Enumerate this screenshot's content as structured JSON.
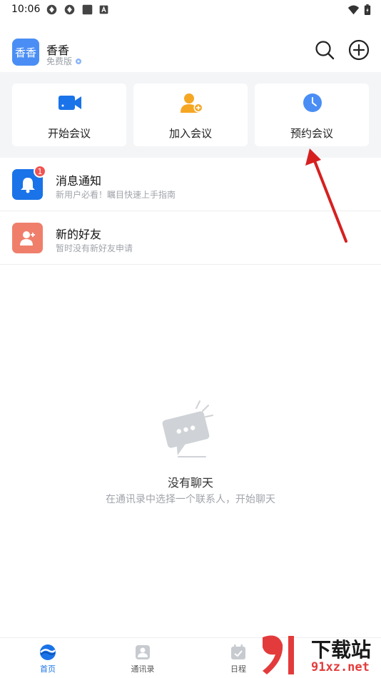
{
  "status_bar": {
    "time": "10:06"
  },
  "header": {
    "avatar_text": "香香",
    "user_name": "香香",
    "plan": "免费版"
  },
  "actions": [
    {
      "label": "开始会议",
      "icon": "video-camera-icon",
      "color": "#1a73e8"
    },
    {
      "label": "加入会议",
      "icon": "add-person-icon",
      "color": "#f5a623"
    },
    {
      "label": "预约会议",
      "icon": "clock-icon",
      "color": "#4a8ef5"
    }
  ],
  "list": [
    {
      "title": "消息通知",
      "subtitle": "新用户必看！瞩目快速上手指南",
      "badge": "1",
      "icon": "bell-icon",
      "color": "#1a73e8"
    },
    {
      "title": "新的好友",
      "subtitle": "暂时没有新好友申请",
      "icon": "add-friend-icon",
      "color": "#ef7f6b"
    }
  ],
  "empty_state": {
    "title": "没有聊天",
    "subtitle": "在通讯录中选择一个联系人，开始聊天"
  },
  "bottom_nav": [
    {
      "label": "首页",
      "icon": "home-icon",
      "active": true
    },
    {
      "label": "通讯录",
      "icon": "contacts-icon",
      "active": false
    },
    {
      "label": "日程",
      "icon": "calendar-icon",
      "active": false
    }
  ],
  "watermark": {
    "brand": "下载站",
    "domain": "91xz.net"
  },
  "colors": {
    "accent": "#1a73e8",
    "badge": "#f25252",
    "arrow": "#d62020"
  }
}
